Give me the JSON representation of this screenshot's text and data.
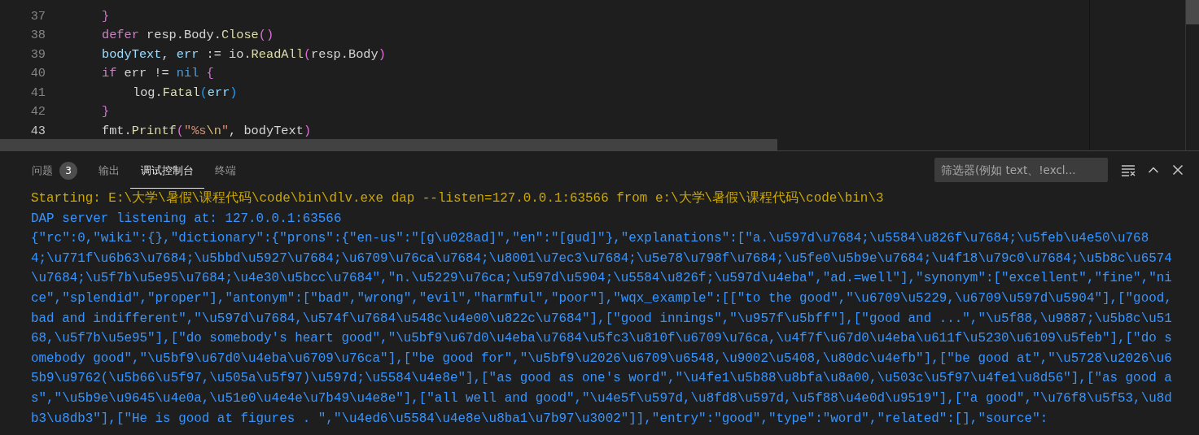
{
  "editor": {
    "lines": [
      {
        "number": "37",
        "tokens": [
          {
            "text": "}",
            "kind": "bracket1"
          }
        ]
      },
      {
        "number": "38",
        "tokens": [
          {
            "text": "defer",
            "kind": "keyword"
          },
          {
            "text": " resp.Body.",
            "kind": "plain"
          },
          {
            "text": "Close",
            "kind": "func"
          },
          {
            "text": "()",
            "kind": "bracket1"
          }
        ]
      },
      {
        "number": "39",
        "tokens": [
          {
            "text": "bodyText",
            "kind": "var"
          },
          {
            "text": ", ",
            "kind": "plain"
          },
          {
            "text": "err",
            "kind": "var"
          },
          {
            "text": " := io.",
            "kind": "plain"
          },
          {
            "text": "ReadAll",
            "kind": "func"
          },
          {
            "text": "(",
            "kind": "bracket1"
          },
          {
            "text": "resp.Body",
            "kind": "plain"
          },
          {
            "text": ")",
            "kind": "bracket1"
          }
        ]
      },
      {
        "number": "40",
        "tokens": [
          {
            "text": "if",
            "kind": "keyword"
          },
          {
            "text": " err != ",
            "kind": "plain"
          },
          {
            "text": "nil",
            "kind": "const"
          },
          {
            "text": " {",
            "kind": "bracket1"
          }
        ],
        "children": [
          {
            "number": "41",
            "tokens": [
              {
                "text": "log.",
                "kind": "plain"
              },
              {
                "text": "Fatal",
                "kind": "func"
              },
              {
                "text": "(",
                "kind": "bracket2"
              },
              {
                "text": "err",
                "kind": "var"
              },
              {
                "text": ")",
                "kind": "bracket2"
              }
            ]
          }
        ]
      },
      {
        "number": "42",
        "tokens": [
          {
            "text": "}",
            "kind": "bracket1"
          }
        ]
      },
      {
        "number": "43",
        "current": true,
        "tokens": [
          {
            "text": "fmt.",
            "kind": "plain"
          },
          {
            "text": "Printf",
            "kind": "func"
          },
          {
            "text": "(",
            "kind": "bracket1"
          },
          {
            "text": "\"%s",
            "kind": "string"
          },
          {
            "text": "\\n",
            "kind": "escape"
          },
          {
            "text": "\"",
            "kind": "string"
          },
          {
            "text": ", bodyText",
            "kind": "plain"
          },
          {
            "text": ")",
            "kind": "bracket1"
          }
        ]
      }
    ]
  },
  "panel": {
    "tabs": [
      {
        "label": "问题",
        "badge": "3",
        "selected": false
      },
      {
        "label": "输出",
        "selected": false
      },
      {
        "label": "调试控制台",
        "selected": true
      },
      {
        "label": "终端",
        "selected": false
      }
    ],
    "filter": {
      "placeholder": "筛选器(例如 text、!excl..."
    },
    "console": [
      {
        "kind": "warning",
        "text": "Starting: E:\\大学\\暑假\\课程代码\\code\\bin\\dlv.exe dap --listen=127.0.0.1:63566 from e:\\大学\\暑假\\课程代码\\code\\bin\\3"
      },
      {
        "kind": "info",
        "text": "DAP server listening at: 127.0.0.1:63566"
      },
      {
        "kind": "info",
        "text": "{\"rc\":0,\"wiki\":{},\"dictionary\":{\"prons\":{\"en-us\":\"[g\\u028ad]\",\"en\":\"[gud]\"},\"explanations\":[\"a.\\u597d\\u7684;\\u5584\\u826f\\u7684;\\u5feb\\u4e50\\u768"
      },
      {
        "kind": "info",
        "text": "4;\\u771f\\u6b63\\u7684;\\u5bbd\\u5927\\u7684;\\u6709\\u76ca\\u7684;\\u8001\\u7ec3\\u7684;\\u5e78\\u798f\\u7684;\\u5fe0\\u5b9e\\u7684;\\u4f18\\u79c0\\u7684;\\u5b8c\\u6574"
      },
      {
        "kind": "info",
        "text": "\\u7684;\\u5f7b\\u5e95\\u7684;\\u4e30\\u5bcc\\u7684\",\"n.\\u5229\\u76ca;\\u597d\\u5904;\\u5584\\u826f;\\u597d\\u4eba\",\"ad.=well\"],\"synonym\":[\"excellent\",\"fine\",\"ni"
      },
      {
        "kind": "info",
        "text": "ce\",\"splendid\",\"proper\"],\"antonym\":[\"bad\",\"wrong\",\"evil\",\"harmful\",\"poor\"],\"wqx_example\":[[\"to the good\",\"\\u6709\\u5229,\\u6709\\u597d\\u5904\"],[\"good,"
      },
      {
        "kind": "info",
        "text": "bad and indifferent\",\"\\u597d\\u7684,\\u574f\\u7684\\u548c\\u4e00\\u822c\\u7684\"],[\"good innings\",\"\\u957f\\u5bff\"],[\"good and ...\",\"\\u5f88,\\u9887;\\u5b8c\\u51"
      },
      {
        "kind": "info",
        "text": "68,\\u5f7b\\u5e95\"],[\"do somebody's heart good\",\"\\u5bf9\\u67d0\\u4eba\\u7684\\u5fc3\\u810f\\u6709\\u76ca,\\u4f7f\\u67d0\\u4eba\\u611f\\u5230\\u6109\\u5feb\"],[\"do s"
      },
      {
        "kind": "info",
        "text": "omebody good\",\"\\u5bf9\\u67d0\\u4eba\\u6709\\u76ca\"],[\"be good for\",\"\\u5bf9\\u2026\\u6709\\u6548,\\u9002\\u5408,\\u80dc\\u4efb\"],[\"be good at\",\"\\u5728\\u2026\\u6"
      },
      {
        "kind": "info",
        "text": "5b9\\u9762(\\u5b66\\u5f97,\\u505a\\u5f97)\\u597d;\\u5584\\u4e8e\"],[\"as good as one's word\",\"\\u4fe1\\u5b88\\u8bfa\\u8a00,\\u503c\\u5f97\\u4fe1\\u8d56\"],[\"as good a"
      },
      {
        "kind": "info",
        "text": "s\",\"\\u5b9e\\u9645\\u4e0a,\\u51e0\\u4e4e\\u7b49\\u4e8e\"],[\"all well and good\",\"\\u4e5f\\u597d,\\u8fd8\\u597d,\\u5f88\\u4e0d\\u9519\"],[\"a good\",\"\\u76f8\\u5f53,\\u8d"
      },
      {
        "kind": "info",
        "text": "b3\\u8db3\"],[\"He is good at figures . \",\"\\u4ed6\\u5584\\u4e8e\\u8ba1\\u7b97\\u3002\"]],\"entry\":\"good\",\"type\":\"word\",\"related\":[],\"source\":"
      }
    ]
  }
}
